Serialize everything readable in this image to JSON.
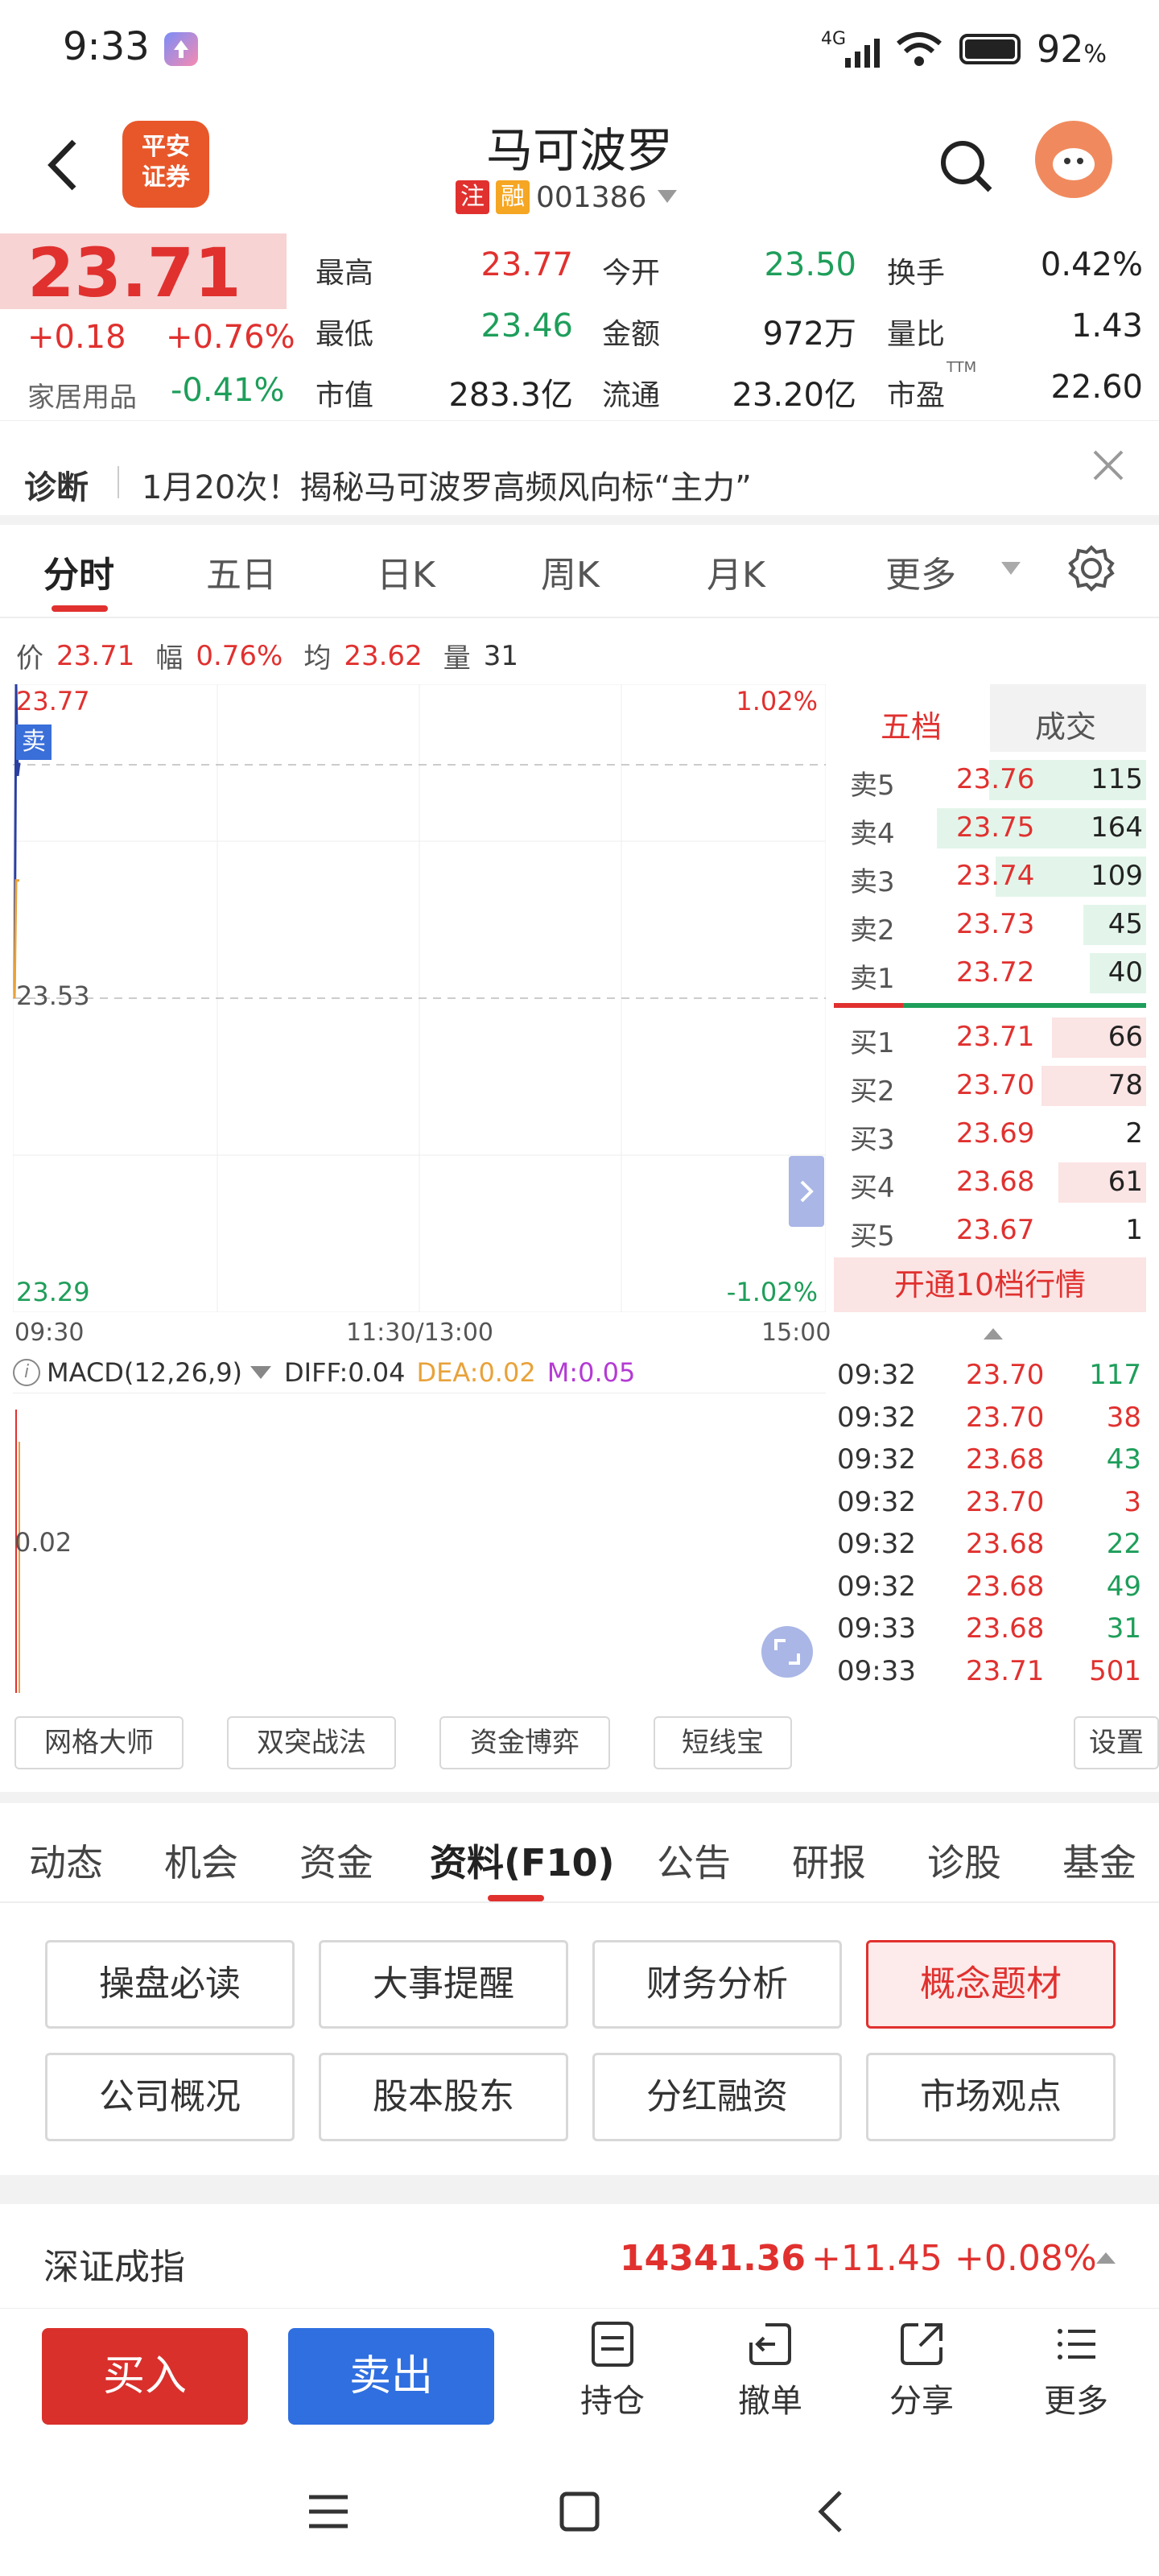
{
  "status_bar": {
    "time": "9:33",
    "network": "4G",
    "battery": "92",
    "battery_unit": "%"
  },
  "header": {
    "broker_logo_line1": "平安",
    "broker_logo_line2": "证券",
    "stock_name": "马可波罗",
    "badge_zhu": "注",
    "badge_rong": "融",
    "stock_code": "001386"
  },
  "quote": {
    "price": "23.71",
    "change": "+0.18",
    "change_pct": "+0.76%",
    "sector": "家居用品",
    "sector_pct": "-0.41%",
    "fields": {
      "high_label": "最高",
      "high": "23.77",
      "open_label": "今开",
      "open": "23.50",
      "turnover_label": "换手",
      "turnover": "0.42%",
      "low_label": "最低",
      "low": "23.46",
      "amount_label": "金额",
      "amount": "972万",
      "vol_ratio_label": "量比",
      "vol_ratio": "1.43",
      "mcap_label": "市值",
      "mcap": "283.3亿",
      "float_label": "流通",
      "float": "23.20亿",
      "pe_label": "市盈",
      "pe_sup": "TTM",
      "pe": "22.60"
    }
  },
  "diagnosis": {
    "label": "诊断",
    "text": "1月20次！揭秘马可波罗高频风向标“主力”"
  },
  "chart_tabs": [
    "分时",
    "五日",
    "日K",
    "周K",
    "月K",
    "更多"
  ],
  "info_bar": {
    "price_label": "价",
    "price": "23.71",
    "amp_label": "幅",
    "amp": "0.76%",
    "avg_label": "均",
    "avg": "23.62",
    "vol_label": "量",
    "vol": "31"
  },
  "intraday": {
    "y_top": "23.77",
    "y_mid": "23.53",
    "y_bottom": "23.29",
    "pct_top": "1.02%",
    "pct_bottom": "-1.02%",
    "sell_marker": "卖",
    "x_labels": [
      "09:30",
      "11:30/13:00",
      "15:00"
    ]
  },
  "chart_data": {
    "type": "line",
    "title": "",
    "ylim": [
      23.29,
      23.77
    ],
    "series": [
      {
        "color": "#2a3fa0",
        "values": [
          23.53,
          23.77,
          23.7,
          23.71
        ]
      },
      {
        "color": "#e8a23a",
        "values": [
          23.53,
          23.62,
          23.62,
          23.62
        ]
      }
    ]
  },
  "order_book": {
    "tab_active": "五档",
    "tab_other": "成交",
    "asks": [
      {
        "label": "卖5",
        "price": "23.76",
        "vol": "115",
        "bar": 0.75
      },
      {
        "label": "卖4",
        "price": "23.75",
        "vol": "164",
        "bar": 1.0
      },
      {
        "label": "卖3",
        "price": "23.74",
        "vol": "109",
        "bar": 0.72
      },
      {
        "label": "卖2",
        "price": "23.73",
        "vol": "45",
        "bar": 0.3
      },
      {
        "label": "卖1",
        "price": "23.72",
        "vol": "40",
        "bar": 0.27
      }
    ],
    "bids": [
      {
        "label": "买1",
        "price": "23.71",
        "vol": "66",
        "bar": 0.45
      },
      {
        "label": "买2",
        "price": "23.70",
        "vol": "78",
        "bar": 0.5
      },
      {
        "label": "买3",
        "price": "23.69",
        "vol": "2",
        "bar": 0.0
      },
      {
        "label": "买4",
        "price": "23.68",
        "vol": "61",
        "bar": 0.42
      },
      {
        "label": "买5",
        "price": "23.67",
        "vol": "1",
        "bar": 0.0
      }
    ],
    "upgrade": "开通10档行情"
  },
  "macd": {
    "name": "MACD(12,26,9)",
    "diff": "DIFF:0.04",
    "dea": "DEA:0.02",
    "m": "M:0.05",
    "y_label": "0.02"
  },
  "ticks": [
    {
      "time": "09:32",
      "price": "23.70",
      "vol": "117",
      "pc": "red",
      "vc": "green"
    },
    {
      "time": "09:32",
      "price": "23.70",
      "vol": "38",
      "pc": "red",
      "vc": "red"
    },
    {
      "time": "09:32",
      "price": "23.68",
      "vol": "43",
      "pc": "red",
      "vc": "green"
    },
    {
      "time": "09:32",
      "price": "23.70",
      "vol": "3",
      "pc": "red",
      "vc": "red"
    },
    {
      "time": "09:32",
      "price": "23.68",
      "vol": "22",
      "pc": "red",
      "vc": "green"
    },
    {
      "time": "09:32",
      "price": "23.68",
      "vol": "49",
      "pc": "red",
      "vc": "green"
    },
    {
      "time": "09:33",
      "price": "23.68",
      "vol": "31",
      "pc": "red",
      "vc": "green"
    },
    {
      "time": "09:33",
      "price": "23.71",
      "vol": "501",
      "pc": "red",
      "vc": "red"
    }
  ],
  "tools": [
    "网格大师",
    "双突战法",
    "资金博弈",
    "短线宝"
  ],
  "tools_setting": "设置",
  "f10_tabs": [
    "动态",
    "机会",
    "资金",
    "资料(F10)",
    "公告",
    "研报",
    "诊股",
    "基金"
  ],
  "f10_buttons": [
    "操盘必读",
    "大事提醒",
    "财务分析",
    "概念题材",
    "公司概况",
    "股本股东",
    "分红融资",
    "市场观点"
  ],
  "index_bar": {
    "name": "深证成指",
    "value": "14341.36",
    "change": "+11.45",
    "pct": "+0.08%"
  },
  "bottom_nav": {
    "buy": "买入",
    "sell": "卖出",
    "items": [
      "持仓",
      "撤单",
      "分享",
      "更多"
    ]
  },
  "colors": {
    "up": "#e0312f",
    "down": "#1e9e5a",
    "sell_btn": "#2f6fe0",
    "buy_btn": "#d9302c"
  }
}
